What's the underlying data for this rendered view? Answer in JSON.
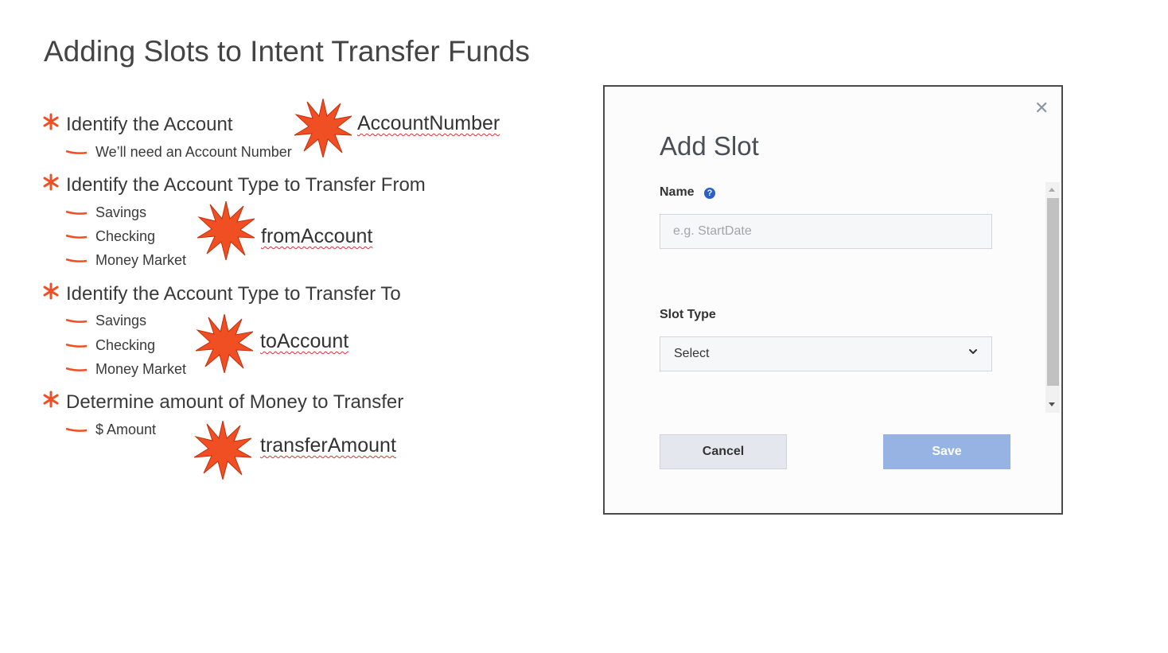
{
  "slide": {
    "title": "Adding Slots to Intent Transfer Funds",
    "bullets": [
      {
        "text": "Identify the Account",
        "subs": [
          "We’ll need an Account Number"
        ],
        "slot": "AccountNumber"
      },
      {
        "text": "Identify the Account Type to Transfer From",
        "subs": [
          "Savings",
          "Checking",
          "Money Market"
        ],
        "slot": "fromAccount"
      },
      {
        "text": "Identify the Account Type to Transfer To",
        "subs": [
          "Savings",
          "Checking",
          "Money Market"
        ],
        "slot": "toAccount"
      },
      {
        "text": "Determine amount of Money to Transfer",
        "subs": [
          "$ Amount"
        ],
        "slot": "transferAmount"
      }
    ]
  },
  "dialog": {
    "title": "Add Slot",
    "close_icon": "✕",
    "name_label": "Name",
    "help_icon": "?",
    "name_placeholder": "e.g. StartDate",
    "slot_type_label": "Slot Type",
    "slot_type_value": "Select",
    "cancel_label": "Cancel",
    "save_label": "Save"
  },
  "colors": {
    "accent": "#f04e23",
    "save_button": "#96b3e4",
    "help_icon": "#2a60c8"
  }
}
